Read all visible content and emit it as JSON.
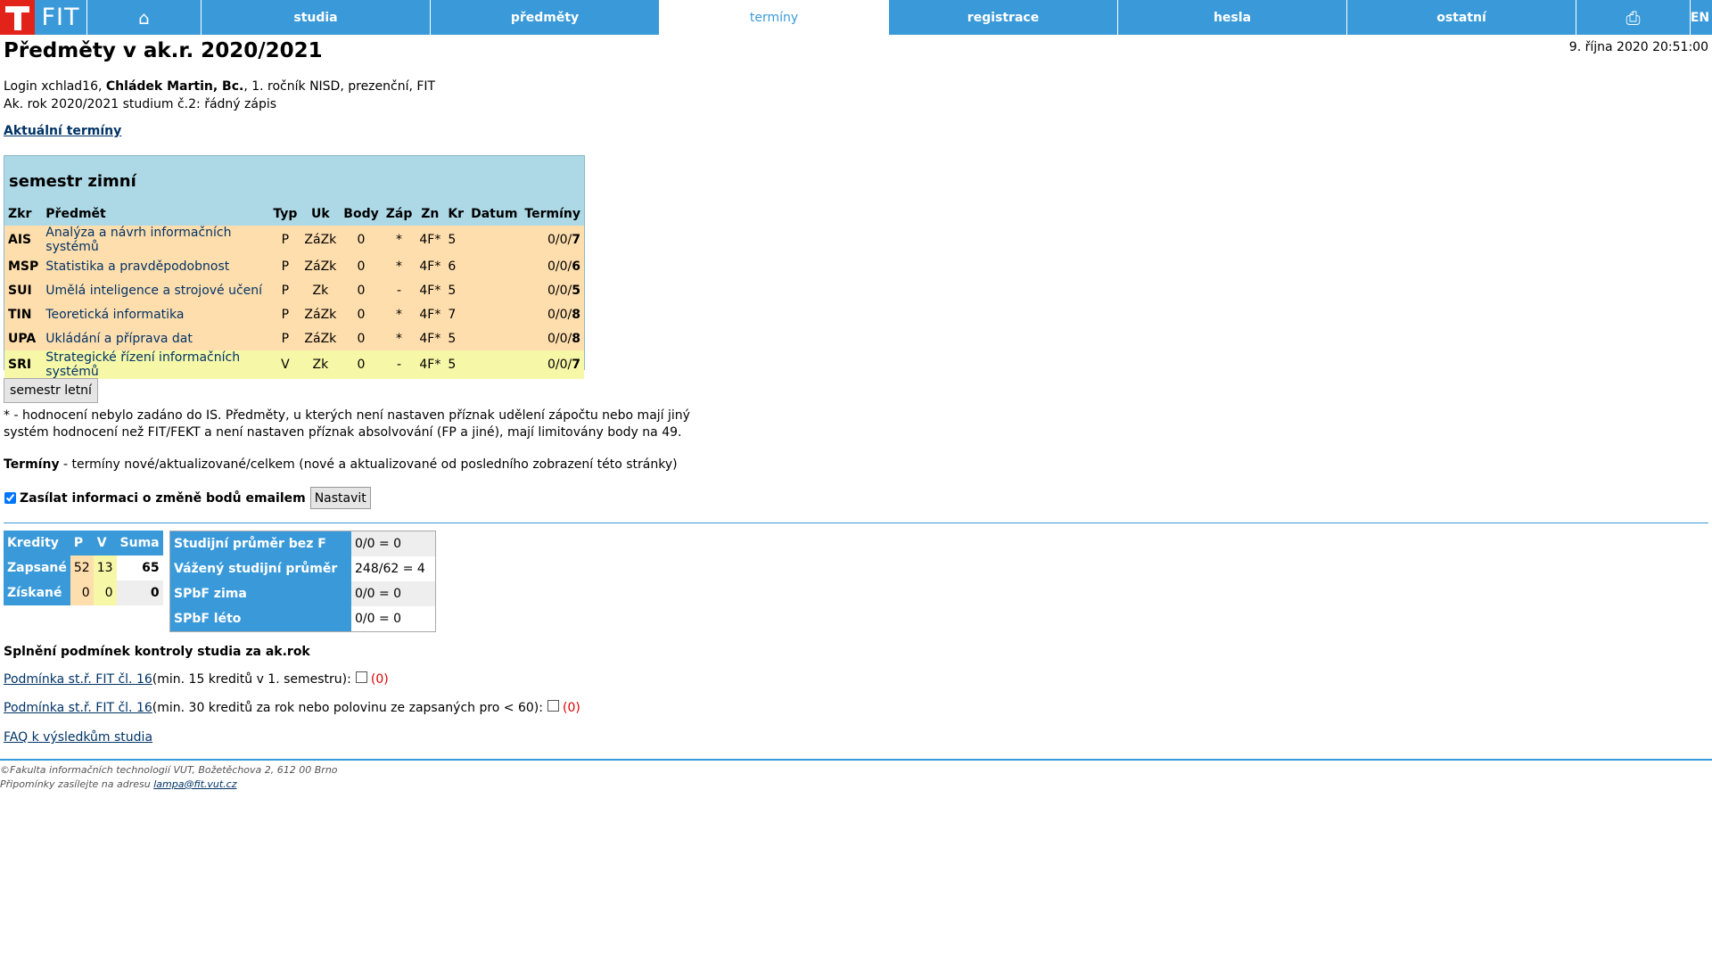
{
  "nav": {
    "logo_text": "FIT",
    "home_icon": "home-icon",
    "items": [
      {
        "label": "studia"
      },
      {
        "label": "předměty"
      },
      {
        "label": "termíny"
      },
      {
        "label": "registrace"
      },
      {
        "label": "hesla"
      },
      {
        "label": "ostatní"
      }
    ],
    "print_icon": "printer-icon",
    "lang": "EN",
    "colors": {
      "nav_blue": "#3a9ad9",
      "logo_red": "#e2231a"
    }
  },
  "header": {
    "title": "Předměty v ak.r. 2020/2021",
    "datetime": "9. října 2020 20:51:00"
  },
  "student": {
    "login_prefix": "Login xchlad16, ",
    "name": "Chládek Martin, Bc.",
    "details": ", 1. ročník NISD, prezenční, FIT",
    "study": "Ak. rok 2020/2021 studium č.2: řádný zápis"
  },
  "current_terms_link": "Aktuální termíny",
  "courses": {
    "semester_title": "semestr zimní",
    "columns": [
      "Zkr",
      "Předmět",
      "Typ",
      "Uk",
      "Body",
      "Záp",
      "Zn",
      "Kr",
      "Datum",
      "Termíny"
    ],
    "rows": [
      {
        "code": "AIS",
        "name": "Analýza a návrh informačních systémů",
        "type": "P",
        "uk": "ZáZk",
        "body": "0",
        "zap": "*",
        "zn": "4F*",
        "kr": "5",
        "datum": "",
        "terms_prefix": "0/0/",
        "terms_total": "7"
      },
      {
        "code": "MSP",
        "name": "Statistika a pravděpodobnost",
        "type": "P",
        "uk": "ZáZk",
        "body": "0",
        "zap": "*",
        "zn": "4F*",
        "kr": "6",
        "datum": "",
        "terms_prefix": "0/0/",
        "terms_total": "6"
      },
      {
        "code": "SUI",
        "name": "Umělá inteligence a strojové učení",
        "type": "P",
        "uk": "Zk",
        "body": "0",
        "zap": "-",
        "zn": "4F*",
        "kr": "5",
        "datum": "",
        "terms_prefix": "0/0/",
        "terms_total": "5"
      },
      {
        "code": "TIN",
        "name": "Teoretická informatika",
        "type": "P",
        "uk": "ZáZk",
        "body": "0",
        "zap": "*",
        "zn": "4F*",
        "kr": "7",
        "datum": "",
        "terms_prefix": "0/0/",
        "terms_total": "8"
      },
      {
        "code": "UPA",
        "name": "Ukládání a příprava dat",
        "type": "P",
        "uk": "ZáZk",
        "body": "0",
        "zap": "*",
        "zn": "4F*",
        "kr": "5",
        "datum": "",
        "terms_prefix": "0/0/",
        "terms_total": "8"
      },
      {
        "code": "SRI",
        "name": "Strategické řízení informačních systémů",
        "type": "V",
        "uk": "Zk",
        "body": "0",
        "zap": "-",
        "zn": "4F*",
        "kr": "5",
        "datum": "",
        "terms_prefix": "0/0/",
        "terms_total": "7"
      }
    ],
    "colors": {
      "header_bg": "#add8e6",
      "mandatory_bg": "#ffdead",
      "elective_bg": "#f7f7a8"
    }
  },
  "summer_button": "semestr letní",
  "note": "* - hodnocení nebylo zadáno do IS. Předměty, u kterých není nastaven příznak udělení zápočtu nebo mají jiný systém hodnocení než FIT/FEKT a není nastaven příznak absolvování (FP a jiné), mají limitovány body na 49.",
  "terms_legend": {
    "label": "Termíny",
    "text": " - termíny nové/aktualizované/celkem (nové a aktualizované od posledního zobrazení této stránky)"
  },
  "email_option": {
    "label": "Zasílat informaci o změně bodů emailem",
    "checked": true,
    "button": "Nastavit"
  },
  "credits": {
    "headers": [
      "Kredity",
      "P",
      "V",
      "Suma"
    ],
    "rows": [
      {
        "label": "Zapsané",
        "p": "52",
        "v": "13",
        "sum": "65"
      },
      {
        "label": "Získané",
        "p": "0",
        "v": "0",
        "sum": "0"
      }
    ]
  },
  "averages": [
    {
      "label": "Studijní průměr bez F",
      "value": "0/0 = 0"
    },
    {
      "label": "Vážený studijní průměr",
      "value": "248/62 = 4"
    },
    {
      "label": "SPbF zima",
      "value": "0/0 = 0"
    },
    {
      "label": "SPbF léto",
      "value": "0/0 = 0"
    }
  ],
  "conditions": {
    "title": "Splnění podmínek kontroly studia za ak.rok",
    "items": [
      {
        "link": "Podmínka st.ř. FIT čl. 16",
        "text": " (min. 15 kreditů v 1. semestru):",
        "value": "(0)",
        "checked": false
      },
      {
        "link": "Podmínka st.ř. FIT čl. 16",
        "text": " (min. 30 kreditů za rok nebo polovinu ze zapsaných pro < 60):",
        "value": "(0)",
        "checked": false
      }
    ]
  },
  "faq_link": "FAQ k výsledkům studia",
  "footer": {
    "line1": "©Fakulta informačních technologií VUT, Božetěchova 2, 612 00 Brno",
    "line2_prefix": "Připomínky zasílejte na adresu ",
    "email": "lampa@fit.vut.cz"
  }
}
